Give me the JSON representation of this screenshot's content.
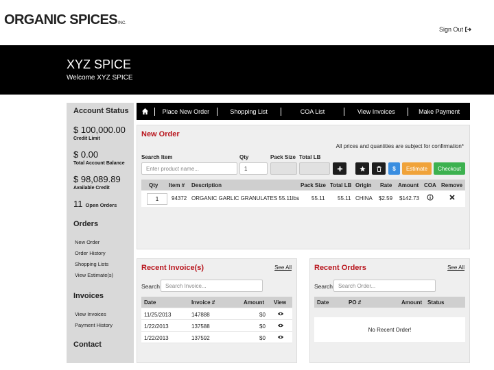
{
  "brand": {
    "logo_text": "ORGANIC SPICES",
    "logo_suffix": "INC.",
    "sign_out_label": "Sign Out"
  },
  "header": {
    "company": "XYZ SPICE",
    "welcome": "Welcome XYZ SPICE"
  },
  "sidebar": {
    "account_status_title": "Account Status",
    "credit_limit": {
      "value": "$ 100,000.00",
      "label": "Credit Limit"
    },
    "total_balance": {
      "value": "$ 0.00",
      "label": "Total Account Balance"
    },
    "available_credit": {
      "value": "$ 98,089.89",
      "label": "Available Credit"
    },
    "open_orders": {
      "value": "11",
      "label": "Open Orders"
    },
    "orders_title": "Orders",
    "order_links": [
      "New Order",
      "Order History",
      "Shopping Lists",
      "View Estimate(s)"
    ],
    "invoices_title": "Invoices",
    "invoice_links": [
      "View Invoices",
      "Payment History"
    ],
    "contact_title": "Contact"
  },
  "nav": {
    "home_icon": "home-icon",
    "items": [
      "Place New Order",
      "Shopping List",
      "COA List",
      "View Invoices",
      "Make Payment"
    ]
  },
  "new_order": {
    "title": "New Order",
    "notice": "All prices and quantities are subject for confirmation*",
    "labels": {
      "search_item": "Search Item",
      "qty": "Qty",
      "pack_size": "Pack Size",
      "total_lb": "Total LB"
    },
    "search_placeholder": "Enter product name...",
    "qty_value": "1",
    "buttons": {
      "add_icon": "plus-icon",
      "favorite_icon": "star-icon",
      "delete_icon": "trash-icon",
      "price_label": "$",
      "estimate": "Estimate",
      "checkout": "Checkout"
    },
    "columns": [
      "Qty",
      "Item #",
      "Description",
      "Pack Size",
      "Total LB",
      "Origin",
      "Rate",
      "Amount",
      "COA",
      "Remove"
    ],
    "rows": [
      {
        "qty": "1",
        "item": "94372",
        "description": "ORGANIC GARLIC GRANULATES 55.11lbs",
        "pack_size": "55.11",
        "total_lb": "55.11",
        "origin": "CHINA",
        "rate": "$2.59",
        "amount": "$142.73",
        "coa_icon": "info-icon",
        "remove_icon": "close-icon"
      }
    ]
  },
  "recent_invoices": {
    "title": "Recent Invoice(s)",
    "see_all": "See All",
    "search_label": "Search",
    "search_placeholder": "Search Invoice...",
    "columns": [
      "Date",
      "Invoice #",
      "Amount",
      "View"
    ],
    "rows": [
      {
        "date": "11/25/2013",
        "invoice": "147888",
        "amount": "$0",
        "view_icon": "eye-icon"
      },
      {
        "date": "1/22/2013",
        "invoice": "137588",
        "amount": "$0",
        "view_icon": "eye-icon"
      },
      {
        "date": "1/22/2013",
        "invoice": "137592",
        "amount": "$0",
        "view_icon": "eye-icon"
      }
    ]
  },
  "recent_orders": {
    "title": "Recent Orders",
    "see_all": "See All",
    "search_label": "Search",
    "search_placeholder": "Search Order...",
    "columns": [
      "Date",
      "PO #",
      "Amount",
      "Status"
    ],
    "empty_message": "No Recent Order!"
  },
  "colors": {
    "accent_red": "#b8141c",
    "header_black": "#000000",
    "sidebar_gray": "#d9d9d9",
    "estimate_orange": "#f0a33a",
    "checkout_green": "#3cb14f",
    "price_blue": "#3a8ee0"
  }
}
